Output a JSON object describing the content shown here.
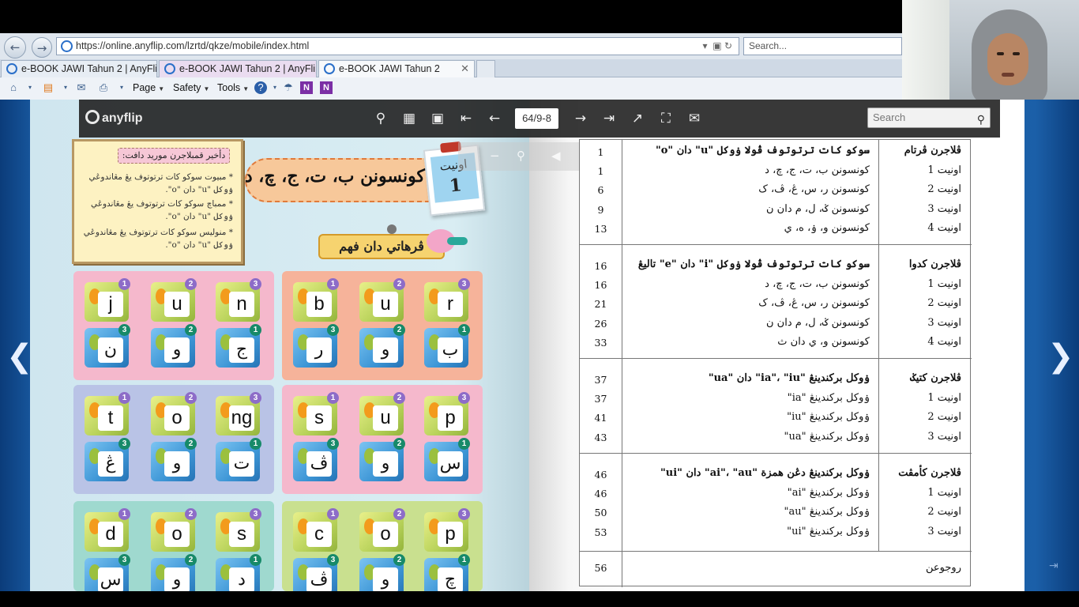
{
  "browser": {
    "url": "https://online.anyflip.com/lzrtd/qkze/mobile/index.html",
    "search_placeholder": "Search...",
    "tabs": [
      {
        "label": "e-BOOK JAWI Tahun 2 | AnyFlip"
      },
      {
        "label": "e-BOOK JAWI Tahun 2 | AnyFlip"
      },
      {
        "label": "e-BOOK JAWI Tahun 2"
      }
    ],
    "commands": {
      "page": "Page",
      "safety": "Safety",
      "tools": "Tools"
    }
  },
  "viewer": {
    "logo": "anyflip",
    "page_number": "64/9-8",
    "search_placeholder": "Search"
  },
  "left_page": {
    "note_title": "دأخير قمبلاجرن موريد دافت:",
    "note_lines": [
      "* مبيوت سوكو كات ترتوتوف يڠ مڠاندوڠي",
      "ۏوكل \"u\" دان \"o\".",
      "* ممباچ سوكو كات ترتوتوف يڠ مڠاندوڠي",
      "ۏوكل \"u\" دان \"o\".",
      "* منوليس سوكو كات ترتوتوف يڠ مڠاندوڠي",
      "ۏوكل \"u\" دان \"o\"."
    ],
    "unit_banner": "كونسونن ب، ت، ج، چ، د",
    "unit_word": "اونيت",
    "unit_number": "1",
    "listen_label": "ڤرهاتي دان فهم",
    "panels": [
      {
        "color": "#f5b8cc",
        "top": [
          "j",
          "u",
          "n"
        ],
        "bottom": [
          "ن",
          "و",
          "ج"
        ]
      },
      {
        "color": "#f6b39a",
        "top": [
          "b",
          "u",
          "r"
        ],
        "bottom": [
          "ر",
          "و",
          "ب"
        ]
      },
      {
        "color": "#b9c3e6",
        "top": [
          "t",
          "o",
          "ng"
        ],
        "bottom": [
          "ڠ",
          "و",
          "ت"
        ]
      },
      {
        "color": "#f5b8cc",
        "top": [
          "s",
          "u",
          "p"
        ],
        "bottom": [
          "ڤ",
          "و",
          "س"
        ]
      },
      {
        "color": "#9fd9cf",
        "top": [
          "d",
          "o",
          "s"
        ],
        "bottom": [
          "س",
          "و",
          "د"
        ]
      },
      {
        "color": "#c9e08f",
        "top": [
          "c",
          "o",
          "p"
        ],
        "bottom": [
          "ڤ",
          "و",
          "چ"
        ]
      }
    ],
    "badges_top": [
      "1",
      "2",
      "3"
    ],
    "badges_bottom": [
      "3",
      "2",
      "1"
    ]
  },
  "toc": {
    "sections": [
      {
        "title": "ڤلاجرن ڤرتام",
        "head_text": "سوكو كات ترتوتوف ڤولا ۏوكل \"u\" دان \"o\"",
        "head_page": "1",
        "rows": [
          {
            "unit": "اونيت 1",
            "text": "كونسونن ب، ت، ج، چ، د",
            "page": "1"
          },
          {
            "unit": "اونيت 2",
            "text": "كونسونن ر، س، ڠ، ڤ، ک",
            "page": "6"
          },
          {
            "unit": "اونيت 3",
            "text": "كونسونن ݢ، ل، م دان ن",
            "page": "9"
          },
          {
            "unit": "اونيت 4",
            "text": "كونسونن و، ۏ، ه، ي",
            "page": "13"
          }
        ]
      },
      {
        "title": "ڤلاجرن كدوا",
        "head_text": "سوكو كات ترتوتوف ڤولا ۏوكل \"i\" دان \"e\" تاليڠ",
        "head_page": "16",
        "rows": [
          {
            "unit": "اونيت 1",
            "text": "كونسونن ب، ت، ج، چ، د",
            "page": "16"
          },
          {
            "unit": "اونيت 2",
            "text": "كونسونن ر، س، ڠ، ڤ، ک",
            "page": "21"
          },
          {
            "unit": "اونيت 3",
            "text": "كونسونن ݢ، ل، م دان ن",
            "page": "26"
          },
          {
            "unit": "اونيت 4",
            "text": "كونسونن و، ي دان ث",
            "page": "33"
          }
        ]
      },
      {
        "title": "ڤلاجرن كتيݢ",
        "head_text": "ۏوكل بركندينڠ \"ia\"، \"iu\" دان \"ua\"",
        "head_page": "37",
        "rows": [
          {
            "unit": "اونيت 1",
            "text": "ۏوكل بركندينڠ \"ia\"",
            "page": "37"
          },
          {
            "unit": "اونيت 2",
            "text": "ۏوكل بركندينڠ \"iu\"",
            "page": "41"
          },
          {
            "unit": "اونيت 3",
            "text": "ۏوكل بركندينڠ \"ua\"",
            "page": "43"
          }
        ]
      },
      {
        "title": "ڤلاجرن كأمڤت",
        "head_text": "ۏوكل بركندينڠ دڠن همزة \"ai\"، \"au\" دان \"ui\"",
        "head_page": "46",
        "rows": [
          {
            "unit": "اونيت 1",
            "text": "ۏوكل بركندينڠ \"ai\"",
            "page": "46"
          },
          {
            "unit": "اونيت 2",
            "text": "ۏوكل بركندينڠ \"au\"",
            "page": "50"
          },
          {
            "unit": "اونيت 3",
            "text": "ۏوكل بركندينڠ \"ui\"",
            "page": "53"
          }
        ]
      }
    ],
    "references_label": "روجوعن",
    "references_page": "56"
  }
}
